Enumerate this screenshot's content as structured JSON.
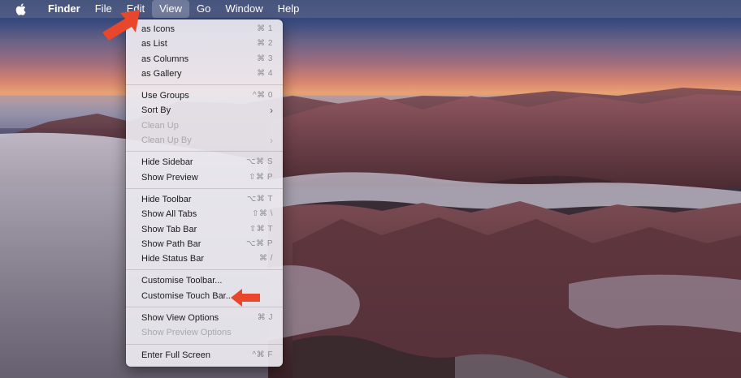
{
  "menubar": {
    "apple_icon": "apple-logo",
    "items": [
      {
        "label": "Finder"
      },
      {
        "label": "File"
      },
      {
        "label": "Edit"
      },
      {
        "label": "View"
      },
      {
        "label": "Go"
      },
      {
        "label": "Window"
      },
      {
        "label": "Help"
      }
    ]
  },
  "view_menu": {
    "groups": [
      [
        {
          "label": "as Icons",
          "shortcut": "⌘ 1"
        },
        {
          "label": "as List",
          "shortcut": "⌘ 2"
        },
        {
          "label": "as Columns",
          "shortcut": "⌘ 3"
        },
        {
          "label": "as Gallery",
          "shortcut": "⌘ 4"
        }
      ],
      [
        {
          "label": "Use Groups",
          "shortcut": "^⌘ 0"
        },
        {
          "label": "Sort By",
          "shortcut": "›"
        },
        {
          "label": "Clean Up",
          "shortcut": ""
        },
        {
          "label": "Clean Up By",
          "shortcut": "›"
        }
      ],
      [
        {
          "label": "Hide Sidebar",
          "shortcut": "⌥⌘ S"
        },
        {
          "label": "Show Preview",
          "shortcut": "⇧⌘ P"
        }
      ],
      [
        {
          "label": "Hide Toolbar",
          "shortcut": "⌥⌘ T"
        },
        {
          "label": "Show All Tabs",
          "shortcut": "⇧⌘ \\"
        },
        {
          "label": "Show Tab Bar",
          "shortcut": "⇧⌘ T"
        },
        {
          "label": "Show Path Bar",
          "shortcut": "⌥⌘ P"
        },
        {
          "label": "Hide Status Bar",
          "shortcut": "⌘ /"
        }
      ],
      [
        {
          "label": "Customise Toolbar...",
          "shortcut": ""
        },
        {
          "label": "Customise Touch Bar...",
          "shortcut": ""
        }
      ],
      [
        {
          "label": "Show View Options",
          "shortcut": "⌘ J"
        },
        {
          "label": "Show Preview Options",
          "shortcut": ""
        }
      ],
      [
        {
          "label": "Enter Full Screen",
          "shortcut": "^⌘ F"
        }
      ]
    ]
  },
  "annotations": {
    "color": "#e8472b"
  }
}
